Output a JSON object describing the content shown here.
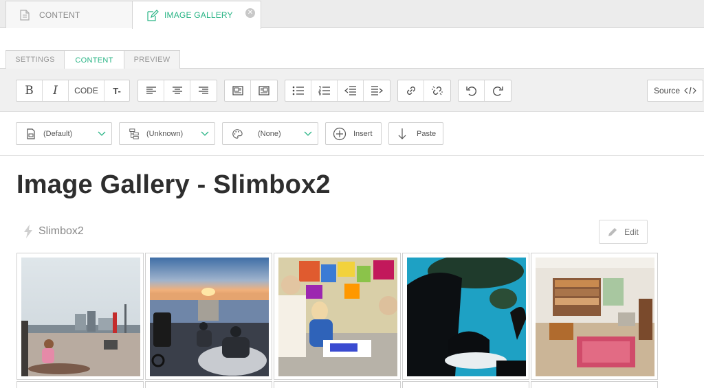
{
  "window_tabs": [
    {
      "label": "CONTENT",
      "active": false
    },
    {
      "label": "IMAGE GALLERY",
      "active": true
    }
  ],
  "sub_tabs": [
    {
      "label": "SETTINGS",
      "active": false
    },
    {
      "label": "CONTENT",
      "active": true
    },
    {
      "label": "PREVIEW",
      "active": false
    }
  ],
  "toolbar": {
    "bold": "B",
    "italic": "I",
    "code": "CODE",
    "clear_format": "T-",
    "source": "Source"
  },
  "format_bar": {
    "style_select": "(Default)",
    "structure_select": "(Unknown)",
    "theme_select": "(None)",
    "insert": "Insert",
    "paste": "Paste"
  },
  "content": {
    "title": "Image Gallery - Slimbox2",
    "module_name": "Slimbox2",
    "edit": "Edit"
  },
  "colors": {
    "accent": "#28b485",
    "border": "#cfcfcf"
  }
}
